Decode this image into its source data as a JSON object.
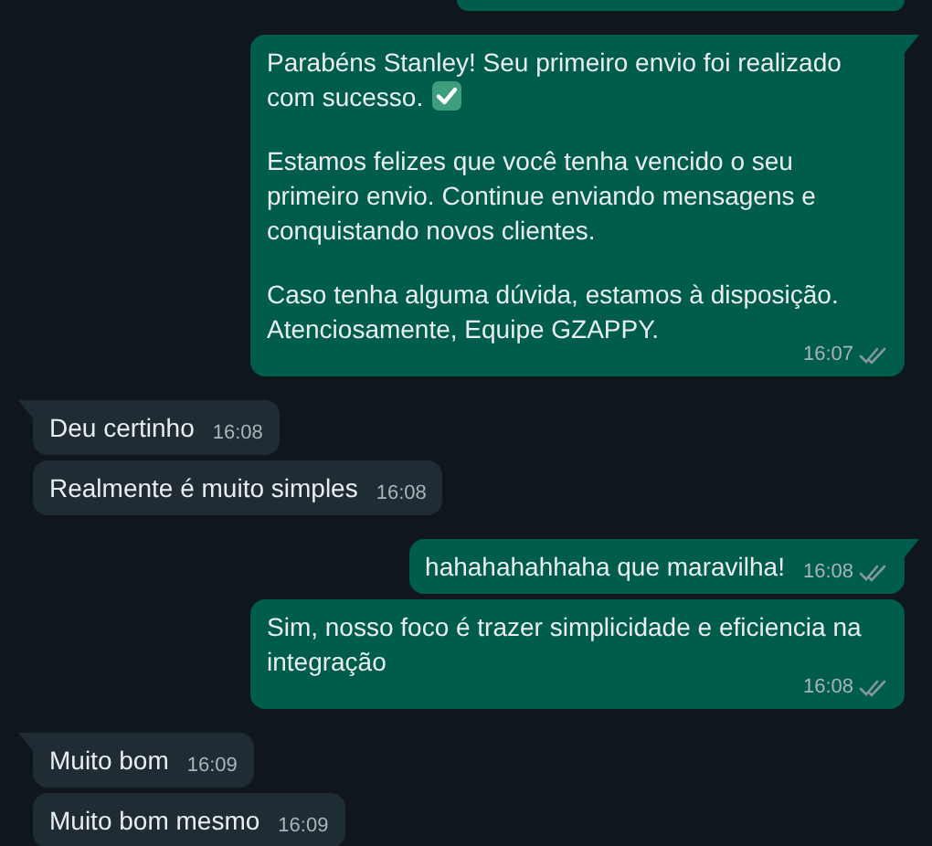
{
  "messages": [
    {
      "kind": "partial"
    },
    {
      "kind": "out",
      "paragraphs": [
        {
          "text": "Parabéns Stanley! Seu primeiro envio foi realizado com sucesso.",
          "emoji": true
        },
        {
          "text": "Estamos felizes que você tenha vencido o seu primeiro envio. Continue enviando mensagens e conquistando novos clientes."
        },
        {
          "text": "Caso tenha alguma dúvida, estamos à disposição. Atenciosamente, Equipe GZAPPY."
        }
      ],
      "time": "16:07"
    },
    {
      "kind": "in",
      "paragraphs": [
        {
          "text": "Deu certinho"
        }
      ],
      "time": "16:08"
    },
    {
      "kind": "in",
      "paragraphs": [
        {
          "text": "Realmente é muito simples"
        }
      ],
      "time": "16:08"
    },
    {
      "kind": "out",
      "paragraphs": [
        {
          "text": "hahahahahhaha que maravilha!"
        }
      ],
      "time": "16:08"
    },
    {
      "kind": "out",
      "paragraphs": [
        {
          "text": "Sim, nosso foco é trazer simplicidade e eficiencia na integração"
        }
      ],
      "time": "16:08"
    },
    {
      "kind": "in",
      "paragraphs": [
        {
          "text": "Muito bom"
        }
      ],
      "time": "16:09"
    },
    {
      "kind": "in",
      "paragraphs": [
        {
          "text": "Muito bom mesmo"
        }
      ],
      "time": "16:09"
    }
  ]
}
